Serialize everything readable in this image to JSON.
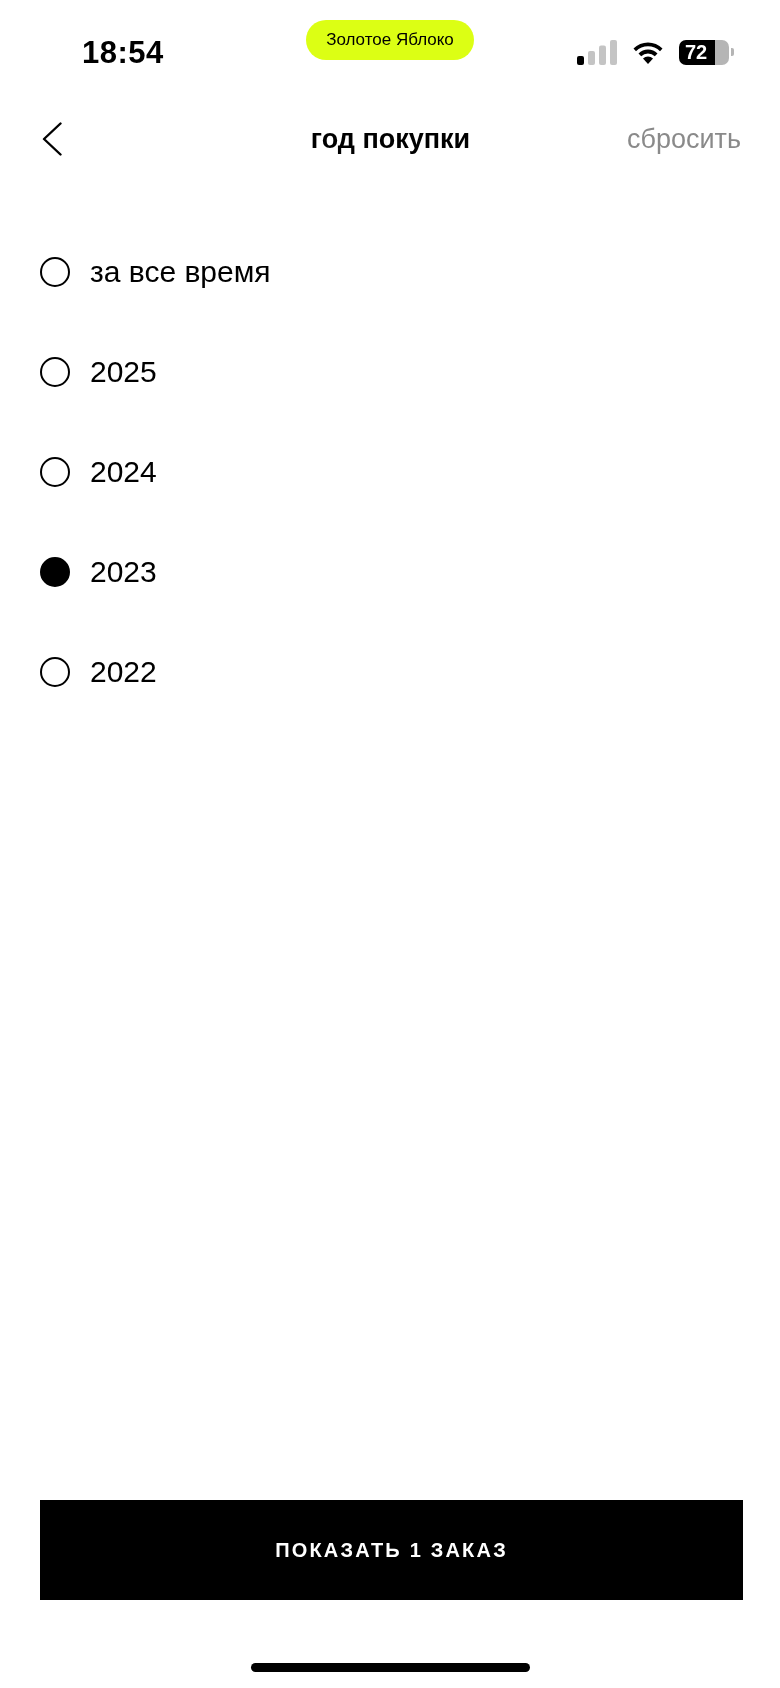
{
  "status_bar": {
    "time": "18:54",
    "app_badge": "Золотое Яблоко",
    "battery": "72"
  },
  "header": {
    "title": "год покупки",
    "reset": "сбросить"
  },
  "options": [
    {
      "label": "за все время",
      "selected": false
    },
    {
      "label": "2025",
      "selected": false
    },
    {
      "label": "2024",
      "selected": false
    },
    {
      "label": "2023",
      "selected": true
    },
    {
      "label": "2022",
      "selected": false
    }
  ],
  "show_button": {
    "label": "ПОКАЗАТЬ 1 ЗАКАЗ"
  }
}
